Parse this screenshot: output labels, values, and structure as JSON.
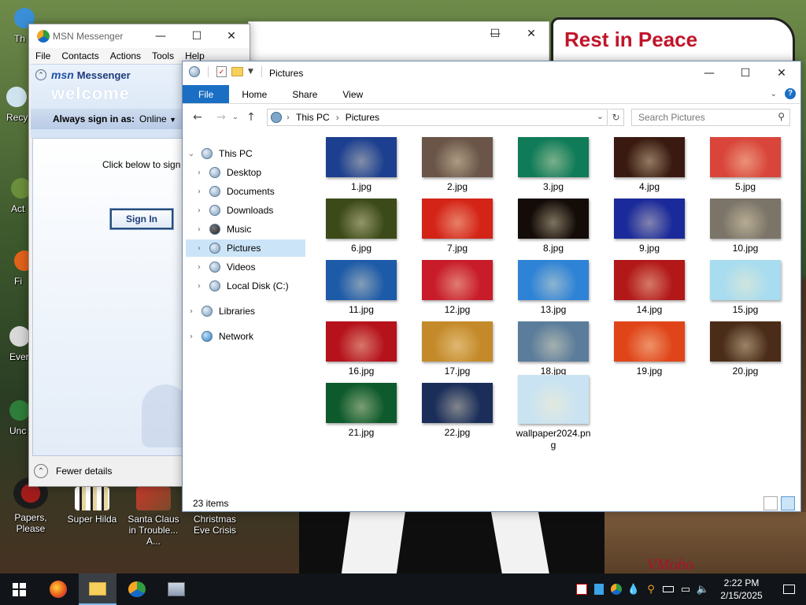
{
  "desktop": {
    "sign_text": "Rest in Peace",
    "brand_text": "VMobo",
    "icons": [
      {
        "label": "Papers, Please"
      },
      {
        "label": "Super Hilda"
      },
      {
        "label": "Santa Claus in Trouble... A..."
      },
      {
        "label": "Christmas Eve Crisis"
      }
    ],
    "partial_icons": [
      {
        "label": "Th"
      },
      {
        "label": "Recy"
      },
      {
        "label": "Act"
      },
      {
        "label": "Fi"
      },
      {
        "label": "Ever"
      },
      {
        "label": "Unc"
      }
    ]
  },
  "msn": {
    "title": "MSN Messenger",
    "menu": [
      "File",
      "Contacts",
      "Actions",
      "Tools",
      "Help"
    ],
    "brand": "msn",
    "brand_suffix": "Messenger",
    "welcome": "welcome",
    "always_sign_in_label": "Always sign in as:",
    "status_value": "Online",
    "click_below": "Click below to sign in:",
    "sign_in_button": "Sign In",
    "fewer_details": "Fewer details"
  },
  "explorer": {
    "title": "Pictures",
    "ribbon_tabs": [
      "File",
      "Home",
      "Share",
      "View"
    ],
    "address": {
      "root": "This PC",
      "current": "Pictures"
    },
    "search_placeholder": "Search Pictures",
    "nav": [
      {
        "label": "This PC",
        "selected": false
      },
      {
        "label": "Desktop",
        "selected": false
      },
      {
        "label": "Documents",
        "selected": false
      },
      {
        "label": "Downloads",
        "selected": false
      },
      {
        "label": "Music",
        "selected": false
      },
      {
        "label": "Pictures",
        "selected": true
      },
      {
        "label": "Videos",
        "selected": false
      },
      {
        "label": "Local Disk (C:)",
        "selected": false
      },
      {
        "label": "Libraries",
        "selected": false
      },
      {
        "label": "Network",
        "selected": false
      }
    ],
    "files": [
      {
        "name": "1.jpg",
        "bg": "#1c3f8f"
      },
      {
        "name": "2.jpg",
        "bg": "#6a5548"
      },
      {
        "name": "3.jpg",
        "bg": "#0f7b58"
      },
      {
        "name": "4.jpg",
        "bg": "#3a1a10"
      },
      {
        "name": "5.jpg",
        "bg": "#d9453a"
      },
      {
        "name": "6.jpg",
        "bg": "#3b4a18"
      },
      {
        "name": "7.jpg",
        "bg": "#d42418"
      },
      {
        "name": "8.jpg",
        "bg": "#140c08"
      },
      {
        "name": "9.jpg",
        "bg": "#1b2a9a"
      },
      {
        "name": "10.jpg",
        "bg": "#7b7468"
      },
      {
        "name": "11.jpg",
        "bg": "#1d5aa8"
      },
      {
        "name": "12.jpg",
        "bg": "#c81c2a"
      },
      {
        "name": "13.jpg",
        "bg": "#2f83d6"
      },
      {
        "name": "14.jpg",
        "bg": "#b21818"
      },
      {
        "name": "15.jpg",
        "bg": "#a8dcef"
      },
      {
        "name": "16.jpg",
        "bg": "#b5121c"
      },
      {
        "name": "17.jpg",
        "bg": "#c48a2a"
      },
      {
        "name": "18.jpg",
        "bg": "#5b7c9a"
      },
      {
        "name": "19.jpg",
        "bg": "#e0451a"
      },
      {
        "name": "20.jpg",
        "bg": "#4a2c18"
      },
      {
        "name": "21.jpg",
        "bg": "#0d5a2c"
      },
      {
        "name": "22.jpg",
        "bg": "#1b2e5a"
      },
      {
        "name": "wallpaper2024.png",
        "bg": "#c9e3f2"
      }
    ],
    "item_count": "23 items"
  },
  "taskbar": {
    "time": "2:22 PM",
    "date": "2/15/2025"
  },
  "colors": {
    "accent": "#1a6fc4",
    "selection": "#cce4f7",
    "taskbar": "#111418"
  }
}
